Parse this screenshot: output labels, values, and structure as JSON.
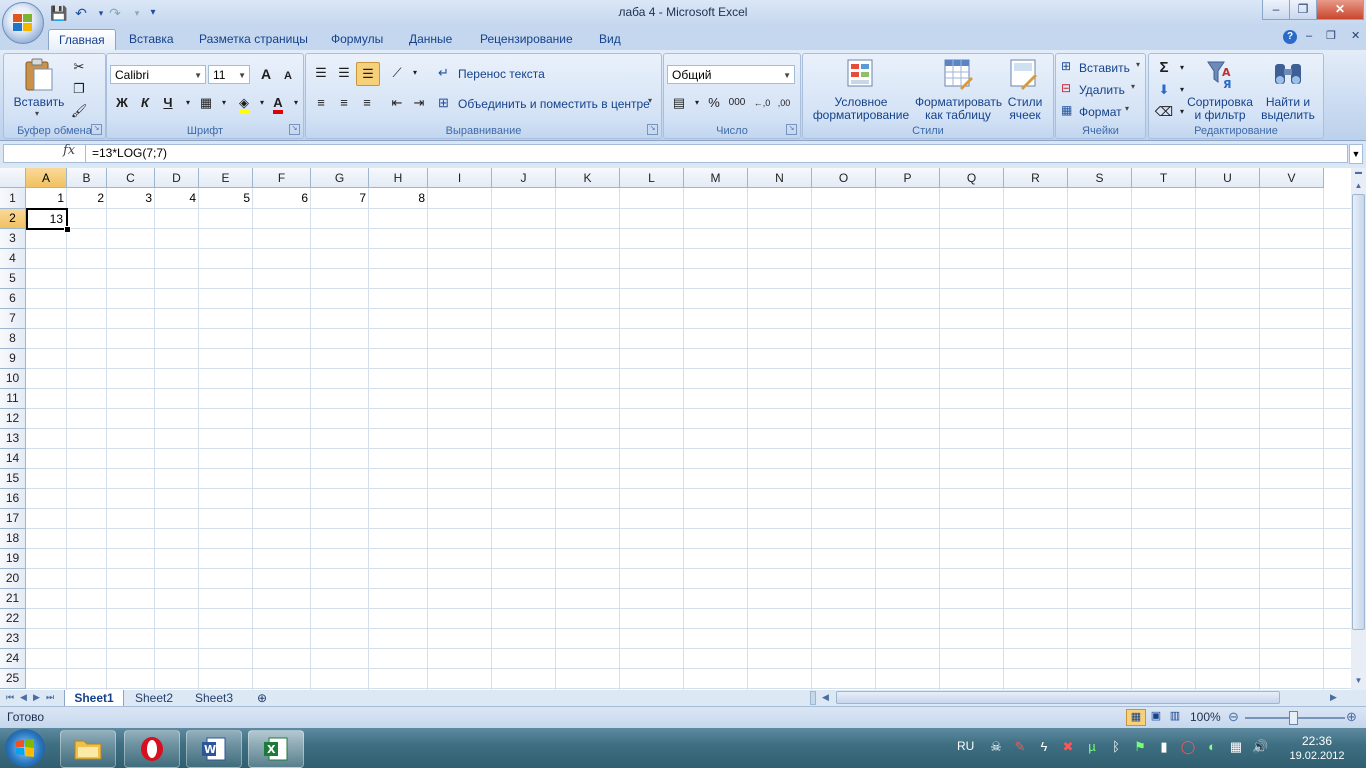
{
  "window": {
    "title": "лаба 4 - Microsoft Excel",
    "min_label": "–",
    "max_label": "❐",
    "close_label": "✕"
  },
  "quick_access": {
    "save_icon": "💾",
    "undo_icon": "↶",
    "redo_icon": "↷",
    "customize_icon": "▾"
  },
  "ribbon_tabs": [
    "Главная",
    "Вставка",
    "Разметка страницы",
    "Формулы",
    "Данные",
    "Рецензирование",
    "Вид"
  ],
  "ribbon": {
    "clipboard": {
      "label": "Буфер обмена",
      "paste": "Вставить"
    },
    "font": {
      "label": "Шрифт",
      "name": "Calibri",
      "size": "11",
      "bold": "Ж",
      "italic": "К",
      "underline": "Ч",
      "grow": "A",
      "shrink": "A"
    },
    "alignment": {
      "label": "Выравнивание",
      "wrap": "Перенос текста",
      "merge": "Объединить и поместить в центре"
    },
    "number": {
      "label": "Число",
      "format": "Общий",
      "percent": "%",
      "thousands": "000",
      "inc_dec": "←,0",
      "dec_dec": ",00"
    },
    "styles": {
      "label": "Стили",
      "conditional": "Условное",
      "conditional2": "форматирование",
      "as_table": "Форматировать",
      "as_table2": "как таблицу",
      "cell_styles": "Стили",
      "cell_styles2": "ячеек"
    },
    "cells": {
      "label": "Ячейки",
      "insert": "Вставить",
      "delete": "Удалить",
      "format": "Формат"
    },
    "editing": {
      "label": "Редактирование",
      "sum": "Σ",
      "sort": "Сортировка",
      "sort2": "и фильтр",
      "find": "Найти и",
      "find2": "выделить"
    }
  },
  "formula_bar": {
    "name_box": "",
    "fx": "fx",
    "formula": "=13*LOG(7;7)"
  },
  "grid": {
    "columns": [
      "A",
      "B",
      "C",
      "D",
      "E",
      "F",
      "G",
      "H",
      "I",
      "J",
      "K",
      "L",
      "M",
      "N",
      "O",
      "P",
      "Q",
      "R",
      "S",
      "T",
      "U",
      "V"
    ],
    "rows": [
      "1",
      "2",
      "3",
      "4",
      "5",
      "6",
      "7",
      "8",
      "9",
      "10",
      "11",
      "12",
      "13",
      "14",
      "15",
      "16",
      "17",
      "18",
      "19",
      "20",
      "21",
      "22",
      "23",
      "24",
      "25"
    ],
    "row1": [
      "1",
      "2",
      "3",
      "4",
      "5",
      "6",
      "7",
      "8"
    ],
    "a2": "13",
    "selected_column": "A",
    "selected_row": "2"
  },
  "sheets": [
    "Sheet1",
    "Sheet2",
    "Sheet3"
  ],
  "status": {
    "ready": "Готово",
    "zoom": "100%"
  },
  "taskbar": {
    "lang": "RU",
    "time": "22:36",
    "date": "19.02.2012"
  },
  "colors": {
    "ribbon_bg": "#c7d9f0",
    "accent": "#15428b",
    "selection": "#f1c15f",
    "excel_green": "#1d7a3a",
    "word_blue": "#2b579a",
    "opera_red": "#d80f1f"
  }
}
